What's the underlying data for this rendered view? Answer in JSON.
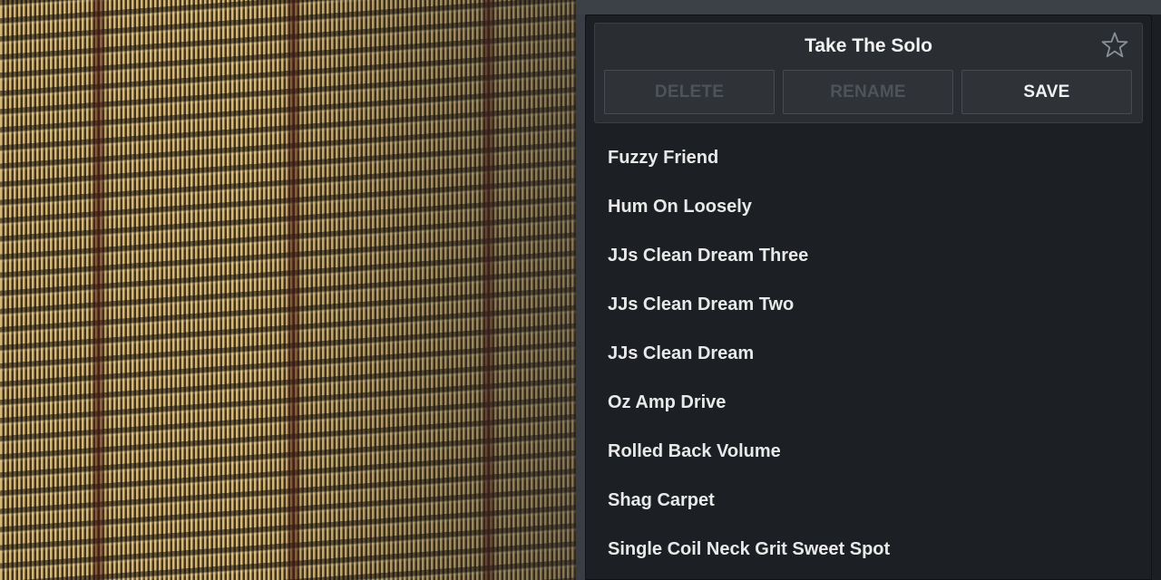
{
  "preset": {
    "title": "Take The Solo",
    "favorite_icon": "star-icon"
  },
  "actions": {
    "delete_label": "DELETE",
    "rename_label": "RENAME",
    "save_label": "SAVE"
  },
  "presets": [
    "Fuzzy Friend",
    "Hum On Loosely",
    "JJs Clean Dream Three",
    "JJs Clean Dream Two",
    "JJs Clean Dream",
    "Oz Amp Drive",
    "Rolled Back Volume",
    "Shag Carpet",
    "Single Coil Neck Grit Sweet Spot"
  ],
  "colors": {
    "panel_bg": "#1c2024",
    "header_bg": "#2a2e33",
    "text": "#f2f2f2",
    "disabled_text": "#4e535a"
  }
}
